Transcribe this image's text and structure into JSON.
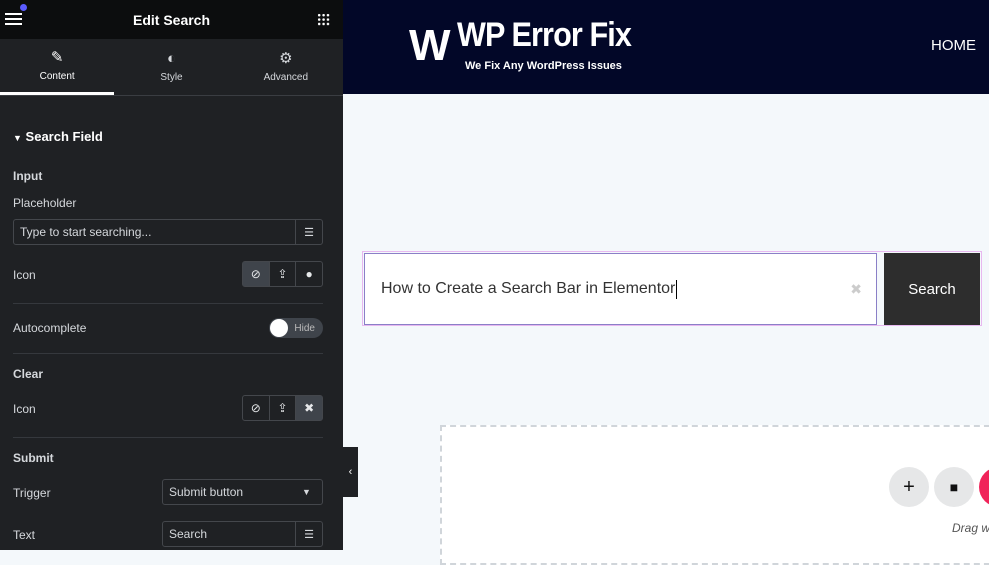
{
  "panel": {
    "title": "Edit Search",
    "tabs": [
      {
        "label": "Content",
        "icon": "pencil-icon"
      },
      {
        "label": "Style",
        "icon": "contrast-icon"
      },
      {
        "label": "Advanced",
        "icon": "gear-icon"
      }
    ],
    "section": "Search Field",
    "input": {
      "heading": "Input",
      "placeholder_label": "Placeholder",
      "placeholder_value": "Type to start searching...",
      "icon_label": "Icon"
    },
    "autocomplete": {
      "label": "Autocomplete",
      "toggle": "Hide",
      "enabled": false
    },
    "clear": {
      "heading": "Clear",
      "icon_label": "Icon"
    },
    "submit": {
      "heading": "Submit",
      "trigger_label": "Trigger",
      "trigger_value": "Submit button",
      "text_label": "Text",
      "text_value": "Search"
    }
  },
  "site": {
    "logo_main": "WP Error Fix",
    "logo_tagline": "We Fix Any WordPress Issues",
    "nav": [
      "HOME"
    ]
  },
  "search": {
    "value": "How to Create a Search Bar in Elementor",
    "button": "Search"
  },
  "dropzone": {
    "hint": "Drag w"
  },
  "colors": {
    "header": "#020728",
    "panel": "#1f2124",
    "accent": "#f0245a"
  }
}
